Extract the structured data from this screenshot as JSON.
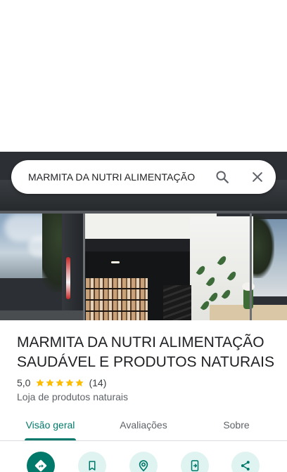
{
  "search": {
    "query": "MARMITA DA NUTRI ALIMENTAÇÃO",
    "search_icon": "search-icon",
    "close_icon": "close-icon"
  },
  "place": {
    "name": "MARMITA DA NUTRI ALIMENTAÇÃO SAUDÁVEL E PRODUTOS NATURAIS",
    "rating": "5,0",
    "stars": 5,
    "review_count": "(14)",
    "category": "Loja de produtos naturais"
  },
  "tabs": [
    {
      "label": "Visão geral",
      "active": true
    },
    {
      "label": "Avaliações",
      "active": false
    },
    {
      "label": "Sobre",
      "active": false
    }
  ],
  "actions": [
    {
      "icon": "directions-icon"
    },
    {
      "icon": "bookmark-icon"
    },
    {
      "icon": "nearby-icon"
    },
    {
      "icon": "send-to-phone-icon"
    },
    {
      "icon": "share-icon"
    }
  ],
  "colors": {
    "accent": "#00796b",
    "action_bg": "#dff3f0",
    "star": "#fbbc04",
    "text": "#202124",
    "secondary_text": "#5f6368"
  }
}
